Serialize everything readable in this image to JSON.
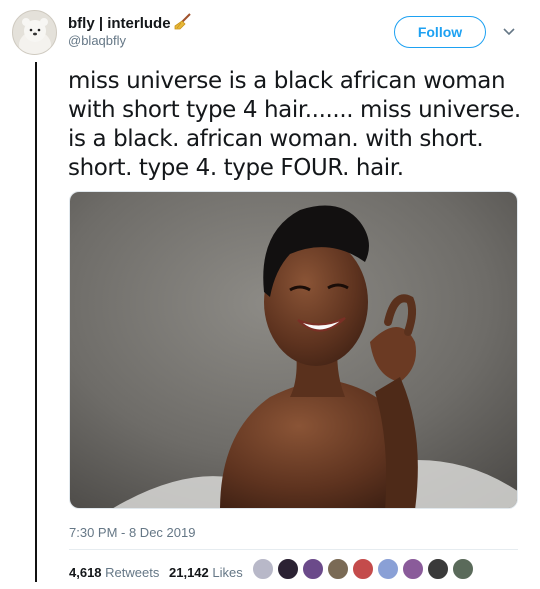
{
  "user": {
    "display_name": "bfly | interlude",
    "handle": "@blaqbfly",
    "follow_label": "Follow"
  },
  "tweet": {
    "lines": [
      "miss universe is a black african woman",
      "with short type 4 hair....... miss universe.",
      "is a black. african woman. with short.",
      "short. type 4. type FOUR. hair."
    ],
    "timestamp": "7:30 PM - 8 Dec 2019"
  },
  "stats": {
    "retweets_count": "4,618",
    "retweets_label": "Retweets",
    "likes_count": "21,142",
    "likes_label": "Likes"
  },
  "likers": [
    {
      "color": "#b8b8c8"
    },
    {
      "color": "#2b2233"
    },
    {
      "color": "#6b4a8a"
    },
    {
      "color": "#7a6a55"
    },
    {
      "color": "#c44b4b"
    },
    {
      "color": "#8aa0d6"
    },
    {
      "color": "#8a5b9a"
    },
    {
      "color": "#3a3a3a"
    },
    {
      "color": "#5a6a5a"
    }
  ],
  "colors": {
    "accent": "#1da1f2",
    "secondary_text": "#657786",
    "thread_line": "#111111"
  },
  "icons": {
    "broom": "broom-icon",
    "chevron": "chevron-down-icon"
  }
}
